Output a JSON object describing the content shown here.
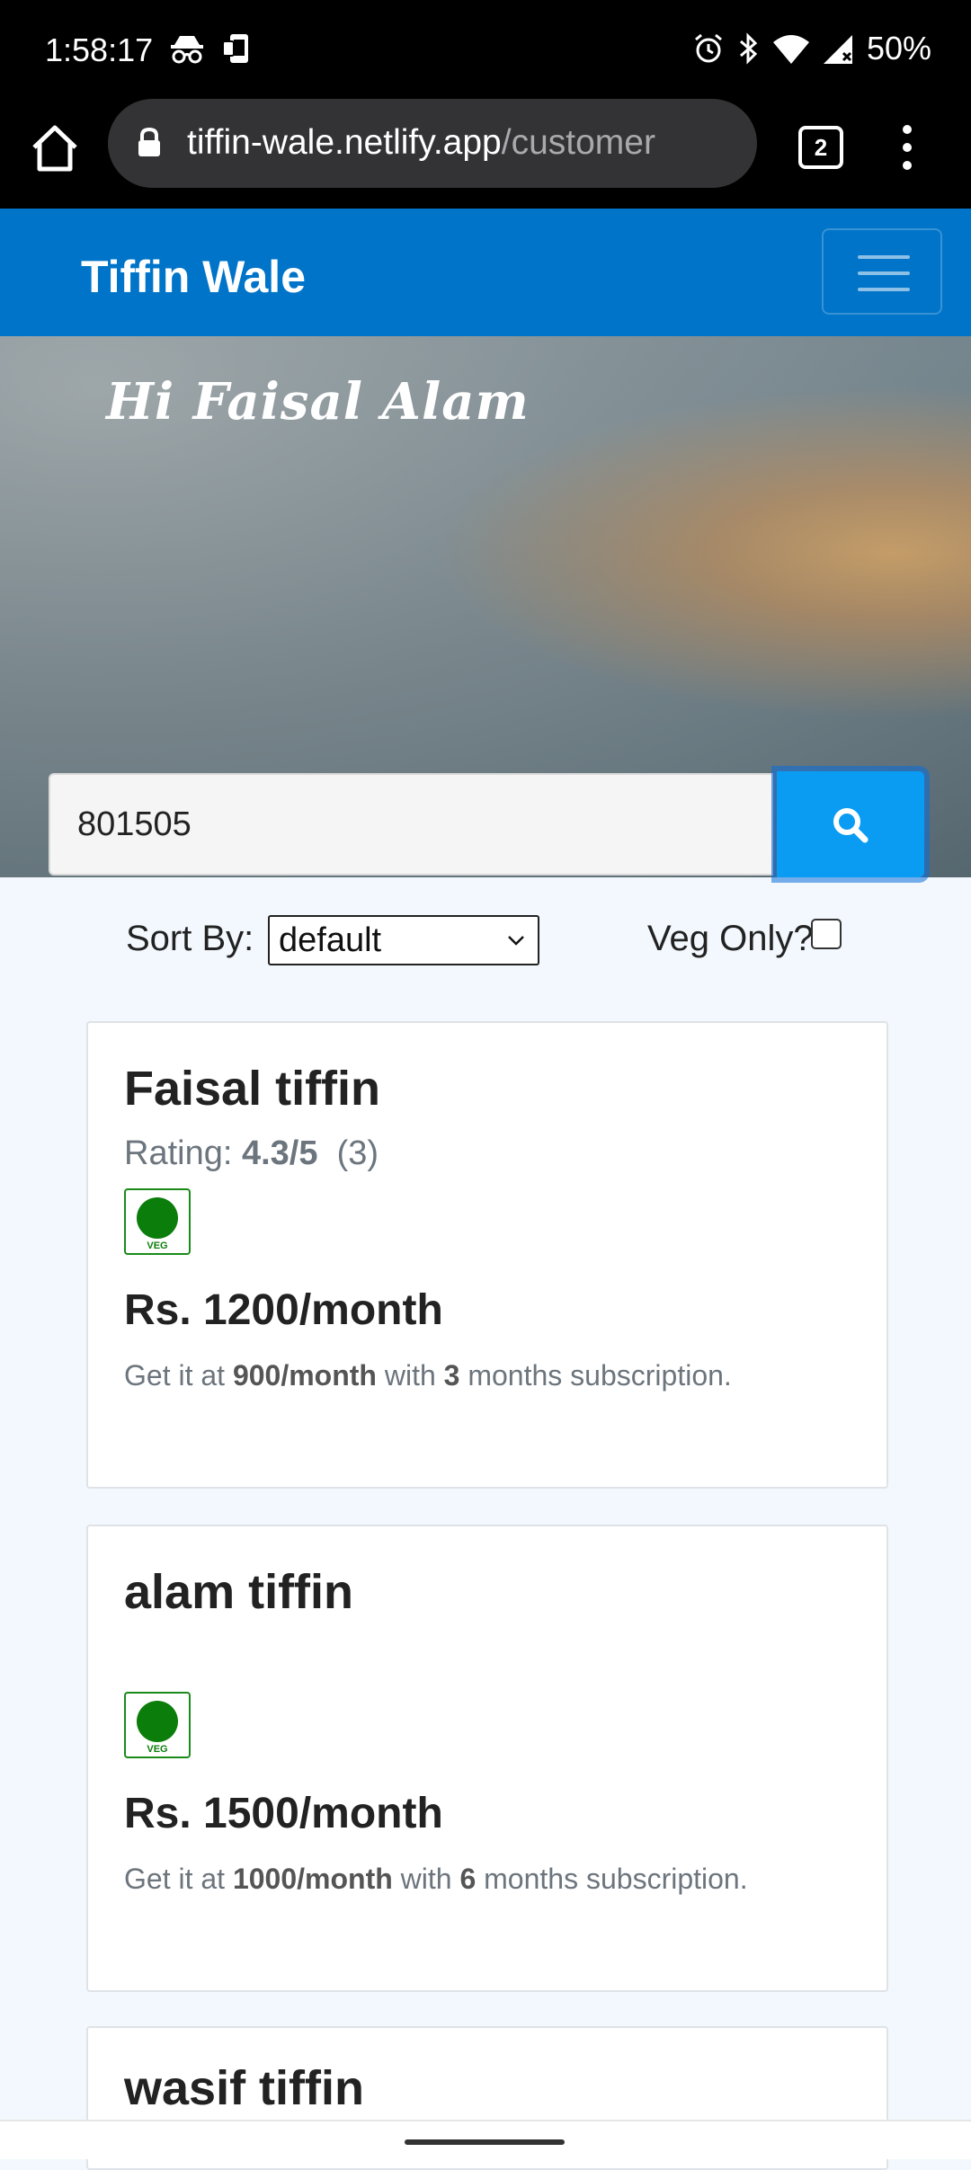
{
  "status_bar": {
    "time": "1:58:17",
    "battery": "50%"
  },
  "browser": {
    "url_domain": "tiffin-wale.netlify.app",
    "url_path": "/customer",
    "tab_count": "2"
  },
  "navbar": {
    "brand": "Tiffin Wale"
  },
  "hero": {
    "greeting": "Hi Faisal Alam"
  },
  "search": {
    "value": "801505"
  },
  "controls": {
    "sort_label": "Sort By:",
    "sort_selected": "default",
    "veg_label": "Veg Only?",
    "veg_checked": false
  },
  "cards": [
    {
      "name": "Faisal tiffin",
      "rating_prefix": "Rating:",
      "rating": "4.3/5",
      "rating_count": "(3)",
      "veg_badge": "VEG",
      "price": "Rs. 1200/month",
      "offer_prefix": "Get it at",
      "offer_price": "900/month",
      "offer_with": "with",
      "offer_months": "3",
      "offer_suffix": "months subscription."
    },
    {
      "name": "alam tiffin",
      "veg_badge": "VEG",
      "price": "Rs. 1500/month",
      "offer_prefix": "Get it at",
      "offer_price": "1000/month",
      "offer_with": "with",
      "offer_months": "6",
      "offer_suffix": "months subscription."
    },
    {
      "name": "wasif tiffin"
    }
  ],
  "colors": {
    "navbar": "#0074c8",
    "search_button": "#0a9cf2",
    "veg_green": "#0b7d0b"
  }
}
